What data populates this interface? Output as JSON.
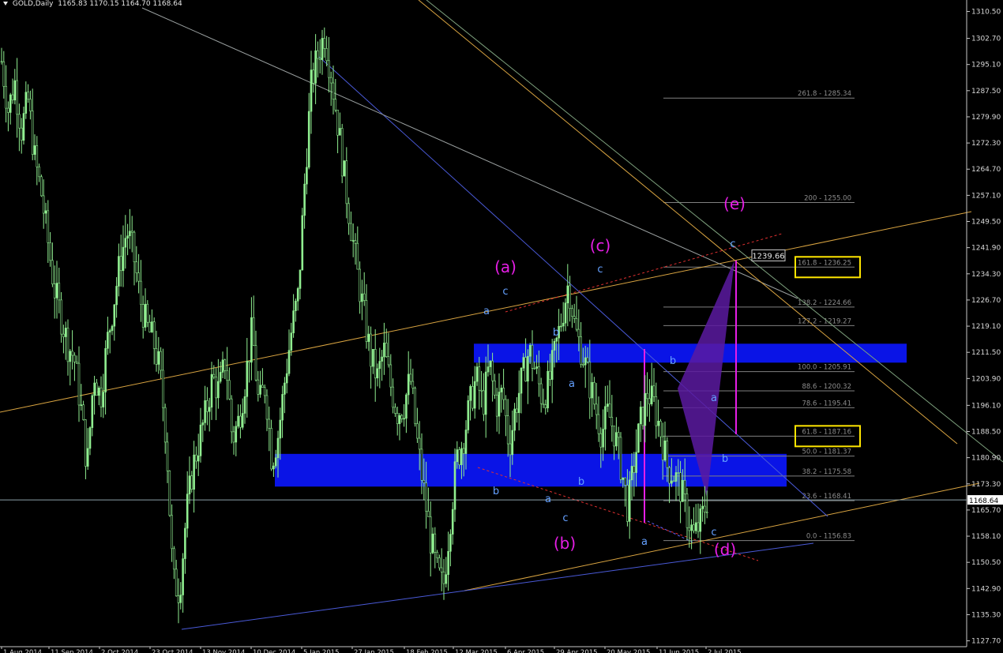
{
  "header": {
    "symbol": "GOLD,Daily",
    "ohlc": "1165.83 1170.15 1164.70 1168.64"
  },
  "chart_data": {
    "type": "candlestick",
    "symbol": "GOLD",
    "timeframe": "Daily",
    "last_price": 1168.64,
    "last_price_label": "1168.64",
    "ylim": [
      1124.0,
      1315.0
    ],
    "y_ticks": [
      "1310.50",
      "1302.70",
      "1295.10",
      "1287.50",
      "1279.90",
      "1272.30",
      "1264.70",
      "1257.10",
      "1249.50",
      "1241.90",
      "1234.30",
      "1226.70",
      "1219.10",
      "1211.50",
      "1203.90",
      "1196.10",
      "1188.50",
      "1180.90",
      "1173.30",
      "1165.70",
      "1158.10",
      "1150.50",
      "1142.90",
      "1135.30",
      "1127.70"
    ],
    "x_ticks": [
      "1 Aug 2014",
      "11 Sep 2014",
      "2 Oct 2014",
      "23 Oct 2014",
      "13 Nov 2014",
      "10 Dec 2014",
      "5 Jan 2015",
      "27 Jan 2015",
      "18 Feb 2015",
      "12 Mar 2015",
      "6 Apr 2015",
      "29 Apr 2015",
      "20 May 2015",
      "11 Jun 2015",
      "2 Jul 2015"
    ],
    "price_path": [
      1296,
      1282,
      1290,
      1276,
      1285,
      1268,
      1258,
      1244,
      1230,
      1222,
      1214,
      1210,
      1196,
      1178,
      1206,
      1198,
      1214,
      1226,
      1238,
      1247,
      1240,
      1227,
      1219,
      1215,
      1206,
      1186,
      1145,
      1142,
      1164,
      1178,
      1186,
      1194,
      1204,
      1200,
      1210,
      1186,
      1192,
      1204,
      1218,
      1196,
      1202,
      1180,
      1188,
      1204,
      1218,
      1228,
      1262,
      1290,
      1298,
      1304,
      1292,
      1278,
      1262,
      1248,
      1234,
      1222,
      1210,
      1204,
      1212,
      1202,
      1194,
      1196,
      1204,
      1186,
      1172,
      1158,
      1148,
      1143,
      1162,
      1180,
      1186,
      1196,
      1204,
      1196,
      1208,
      1196,
      1200,
      1184,
      1196,
      1204,
      1212,
      1206,
      1198,
      1202,
      1212,
      1222,
      1232,
      1218,
      1212,
      1204,
      1196,
      1188,
      1194,
      1188,
      1178,
      1166,
      1180,
      1192,
      1200,
      1196,
      1188,
      1178,
      1176,
      1172,
      1164,
      1158,
      1162,
      1168.64
    ],
    "fib_levels": [
      {
        "label": "261.8 - 1285.34",
        "value": 1285.34
      },
      {
        "label": "200 - 1255.00",
        "value": 1255.0
      },
      {
        "label": "161.8 - 1236.25",
        "value": 1236.25
      },
      {
        "label": "138.2 - 1224.66",
        "value": 1224.66
      },
      {
        "label": "127.2 - 1219.27",
        "value": 1219.27
      },
      {
        "label": "100.0 - 1205.91",
        "value": 1205.91
      },
      {
        "label": "88.6 - 1200.32",
        "value": 1200.32
      },
      {
        "label": "78.6 - 1195.41",
        "value": 1195.41
      },
      {
        "label": "61.8 - 1187.16",
        "value": 1187.16
      },
      {
        "label": "50.0 - 1181.37",
        "value": 1181.37
      },
      {
        "label": "38.2 - 1175.58",
        "value": 1175.58
      },
      {
        "label": "23.6 - 1168.41",
        "value": 1168.41
      },
      {
        "label": "0.0 - 1156.83",
        "value": 1156.83
      }
    ],
    "highlighted_levels": [
      "161.8 - 1236.25",
      "61.8 - 1187.16"
    ],
    "target_label": "1239.66",
    "zones": [
      {
        "from": 1208.5,
        "to": 1214.0
      },
      {
        "from": 1172.5,
        "to": 1182.0
      }
    ],
    "wave_labels_major": [
      "(a)",
      "(b)",
      "(c)",
      "(d)",
      "(e)"
    ],
    "wave_labels_minor": [
      "a",
      "b",
      "c",
      "a",
      "b",
      "c",
      "a",
      "b",
      "c",
      "a",
      "b",
      "c",
      "b",
      "a",
      "b",
      "c"
    ],
    "colors": {
      "background": "#000000",
      "candles": "#90ee90",
      "axis": "#c8c8c8",
      "zone": "#0a14e6",
      "major_wave": "#e61ee6",
      "minor_wave": "#64a0ff",
      "fib": "#808080",
      "highlight": "#ffe600",
      "trend_orange": "#d9a441",
      "trend_blue": "#4a5ad8",
      "trend_gray": "#9aa0a0",
      "projection": "#5a1aa0"
    }
  }
}
